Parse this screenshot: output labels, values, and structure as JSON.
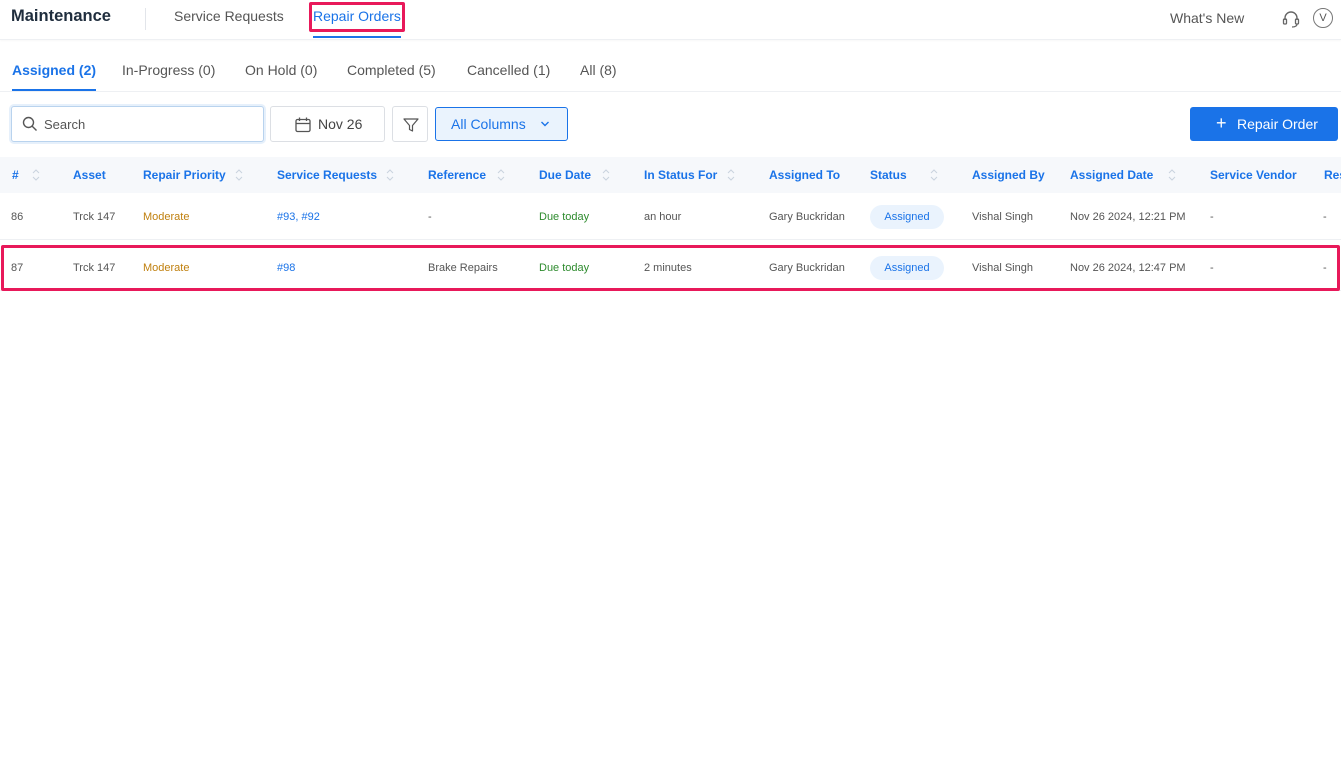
{
  "header": {
    "app_title": "Maintenance",
    "nav": [
      {
        "label": "Service Requests"
      },
      {
        "label": "Repair Orders"
      }
    ],
    "whats_new": "What's New",
    "avatar_initial": "V"
  },
  "subtabs": [
    {
      "label": "Assigned (2)"
    },
    {
      "label": "In-Progress (0)"
    },
    {
      "label": "On Hold (0)"
    },
    {
      "label": "Completed (5)"
    },
    {
      "label": "Cancelled (1)"
    },
    {
      "label": "All (8)"
    }
  ],
  "toolbar": {
    "search_placeholder": "Search",
    "date_label": "Nov 26",
    "columns_label": "All Columns",
    "add_label": "Repair Order",
    "add_icon": "+"
  },
  "table": {
    "columns": [
      "#",
      "Asset",
      "Repair Priority",
      "Service Requests",
      "Reference",
      "Due Date",
      "In Status For",
      "Assigned To",
      "Status",
      "Assigned By",
      "Assigned Date",
      "Service Vendor",
      "Res"
    ],
    "rows": [
      {
        "id": "86",
        "asset": "Trck 147",
        "priority": "Moderate",
        "service_requests": "#93, #92",
        "reference": "-",
        "due_date": "Due today",
        "in_status_for": "an hour",
        "assigned_to": "Gary Buckridan",
        "status": "Assigned",
        "assigned_by": "Vishal Singh",
        "assigned_date": "Nov 26 2024, 12:21 PM",
        "service_vendor": "-",
        "res": "-"
      },
      {
        "id": "87",
        "asset": "Trck 147",
        "priority": "Moderate",
        "service_requests": "#98",
        "reference": "Brake Repairs",
        "due_date": "Due today",
        "in_status_for": "2 minutes",
        "assigned_to": "Gary Buckridan",
        "status": "Assigned",
        "assigned_by": "Vishal Singh",
        "assigned_date": "Nov 26 2024, 12:47 PM",
        "service_vendor": "-",
        "res": "-"
      }
    ]
  },
  "colors": {
    "accent": "#1a73e8",
    "highlight": "#e8195a",
    "priority_moderate": "#c0800f",
    "due_today": "#2e8b2e"
  }
}
